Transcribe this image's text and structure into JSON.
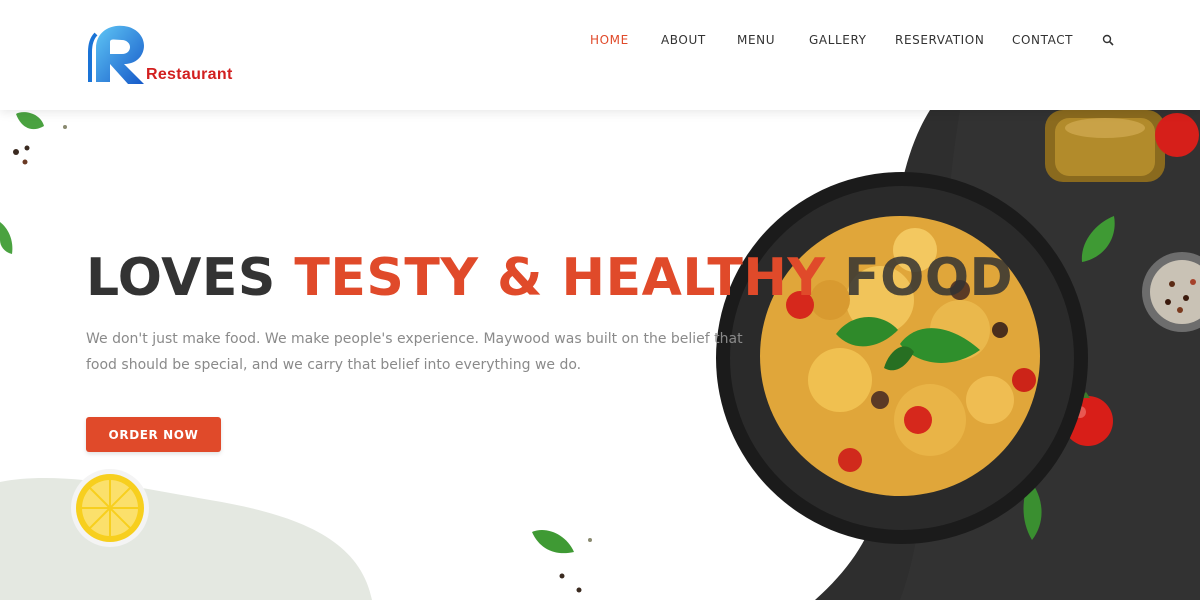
{
  "brand": {
    "name": "Restaurant",
    "logo_icon": "r-logo-icon"
  },
  "nav": {
    "items": [
      {
        "label": "HOME",
        "active": true
      },
      {
        "label": "ABOUT",
        "active": false
      },
      {
        "label": "MENU",
        "active": false
      },
      {
        "label": "GALLERY",
        "active": false
      },
      {
        "label": "RESERVATION",
        "active": false
      },
      {
        "label": "CONTACT",
        "active": false
      }
    ],
    "search_icon": "search-icon"
  },
  "hero": {
    "headline_part1": "LOVES ",
    "headline_part2": "TESTY & HEALTHY ",
    "headline_part3": "FOOD",
    "intro": "We don't just make food. We make people's experience. Maywood was built on the belief that food should be special, and we carry that belief into everything we do.",
    "cta_label": "ORDER NOW"
  },
  "colors": {
    "accent": "#e04a2a",
    "heading": "#333333",
    "body_text": "#8a8a8a",
    "dark_panel": "#2b2b2b",
    "logo_blue": "#1f7fd6",
    "logo_red": "#d21f1f"
  }
}
